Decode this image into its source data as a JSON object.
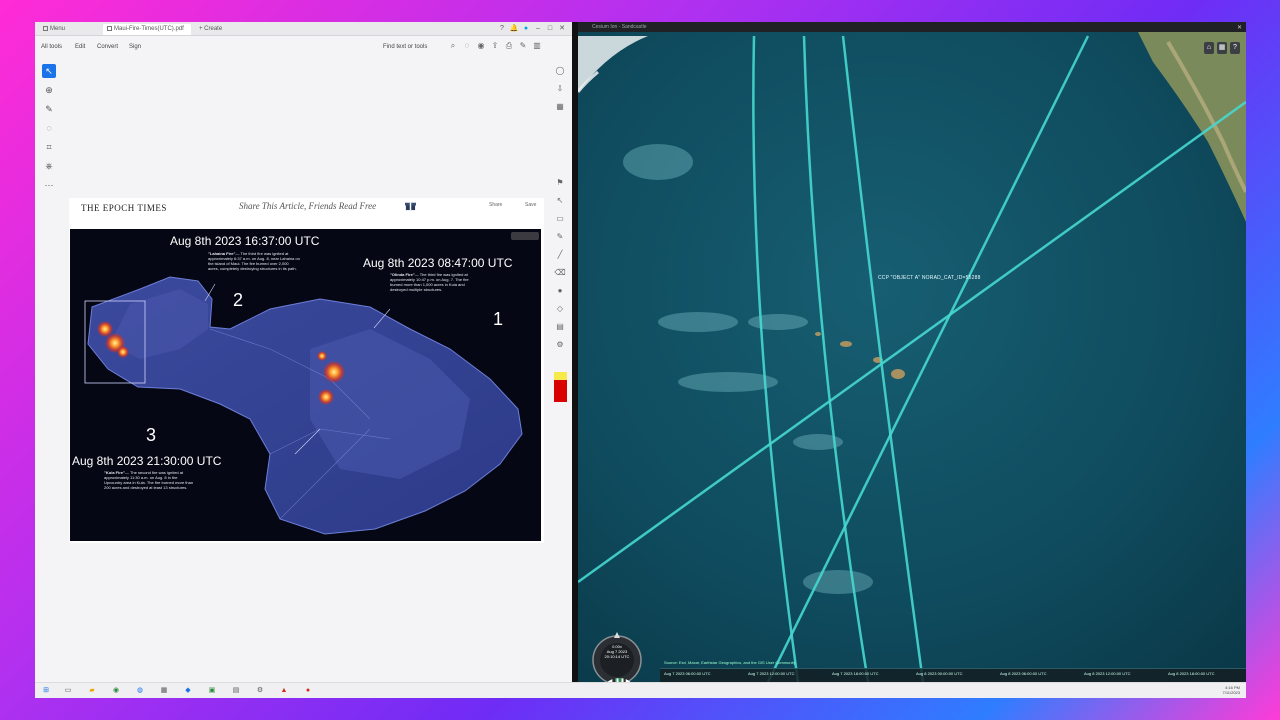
{
  "pdf_viewer": {
    "tabs": [
      {
        "label": "Menu"
      },
      {
        "label": "Maui-Fire-Times(UTC).pdf"
      },
      {
        "label": "+ Create"
      }
    ],
    "menu": {
      "all_tools": "All tools",
      "edit": "Edit",
      "convert": "Convert",
      "sign": "Sign",
      "find": "Find text or tools"
    },
    "page": {
      "publication": "THE EPOCH TIMES",
      "share_text": "Share This Article, Friends Read Free",
      "header_ctrls": [
        "Share",
        "Save"
      ]
    },
    "map_figure": {
      "annotations": [
        {
          "date": "Aug 8th 2023 16:37:00 UTC",
          "number": "2",
          "desc_title": "\"Lahaina Fire\"",
          "desc": "— The third fire was ignited at approximately 6:37 a.m. on Aug. 8, near Lahaina on the island of Maui. The fire burned over 2,000 acres, completely destroying structures in its path."
        },
        {
          "date": "Aug 8th 2023 08:47:00 UTC",
          "number": "1",
          "desc_title": "\"Olinda Fire\"",
          "desc": "— The third fire was ignited at approximately 10:47 p.m. on Aug. 7. The fire burned more than 1,000 acres in Kula and destroyed multiple structures."
        },
        {
          "date": "Aug 8th 2023 21:30:00 UTC",
          "number": "3",
          "desc_title": "\"Kula Fire\"",
          "desc": "— The second fire was ignited at approximately 11:30 a.m. on Aug. 8 in the Upcountry area in Kula. The fire burned more than 200 acres and destroyed at least 13 structures."
        }
      ]
    }
  },
  "globe_viewer": {
    "title": "Cesium Ion - Sandcastle",
    "object_label": "CCP \"OBJECT A\" NORAD_CAT_ID=55288",
    "nav_time": {
      "line1": "0.00x",
      "line2": "Aug 7 2023",
      "line3": "20:10:14 UTC"
    },
    "credits": "Source: Esri, Maxar, Earthstar Geographics, and the GIS User Community",
    "timeline_labels": [
      "Aug 7 2023 06:00:00 UTC",
      "Aug 7 2023 12:00:00 UTC",
      "Aug 7 2023 18:00:00 UTC",
      "Aug 8 2023 00:00:00 UTC",
      "Aug 8 2023 06:00:00 UTC",
      "Aug 8 2023 12:00:00 UTC",
      "Aug 8 2023 18:00:00 UTC"
    ]
  },
  "taskbar": {
    "clock_time": "4:16 PM",
    "clock_date": "7/11/2023"
  },
  "colors": {
    "orbit_track": "#46d8d0",
    "ocean": "#0f4b5e",
    "active_tool": "#1a73e8"
  }
}
